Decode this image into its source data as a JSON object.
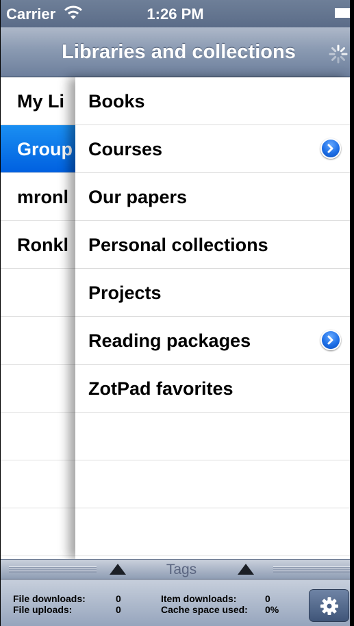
{
  "status": {
    "carrier": "Carrier",
    "time": "1:26 PM"
  },
  "navbar": {
    "title": "Libraries and collections"
  },
  "libraries": [
    {
      "label": "My Li",
      "selected": false
    },
    {
      "label": "Group",
      "selected": true
    },
    {
      "label": "mronl",
      "selected": false
    },
    {
      "label": "Ronkl",
      "selected": false
    }
  ],
  "collections": [
    {
      "label": "Books",
      "has_disclosure": false
    },
    {
      "label": "Courses",
      "has_disclosure": true
    },
    {
      "label": "Our papers",
      "has_disclosure": false
    },
    {
      "label": "Personal collections",
      "has_disclosure": false
    },
    {
      "label": "Projects",
      "has_disclosure": false
    },
    {
      "label": "Reading packages",
      "has_disclosure": true
    },
    {
      "label": "ZotPad favorites",
      "has_disclosure": false
    }
  ],
  "tagbar": {
    "label": "Tags"
  },
  "toolbar": {
    "stats_left": [
      {
        "key": "File downloads:",
        "value": "0"
      },
      {
        "key": "File uploads:",
        "value": "0"
      }
    ],
    "stats_right": [
      {
        "key": "Item downloads:",
        "value": "0"
      },
      {
        "key": "Cache space used:",
        "value": "0%"
      }
    ]
  },
  "colors": {
    "selection": "#0a74ea",
    "navbar": "#8a9ab2",
    "disclosure": "#1e6fe6"
  },
  "icons": {
    "wifi": "wifi-icon",
    "battery": "battery-icon",
    "spinner": "activity-spinner-icon",
    "disclosure": "chevron-right-disclosure-icon",
    "gear": "gear-icon"
  }
}
